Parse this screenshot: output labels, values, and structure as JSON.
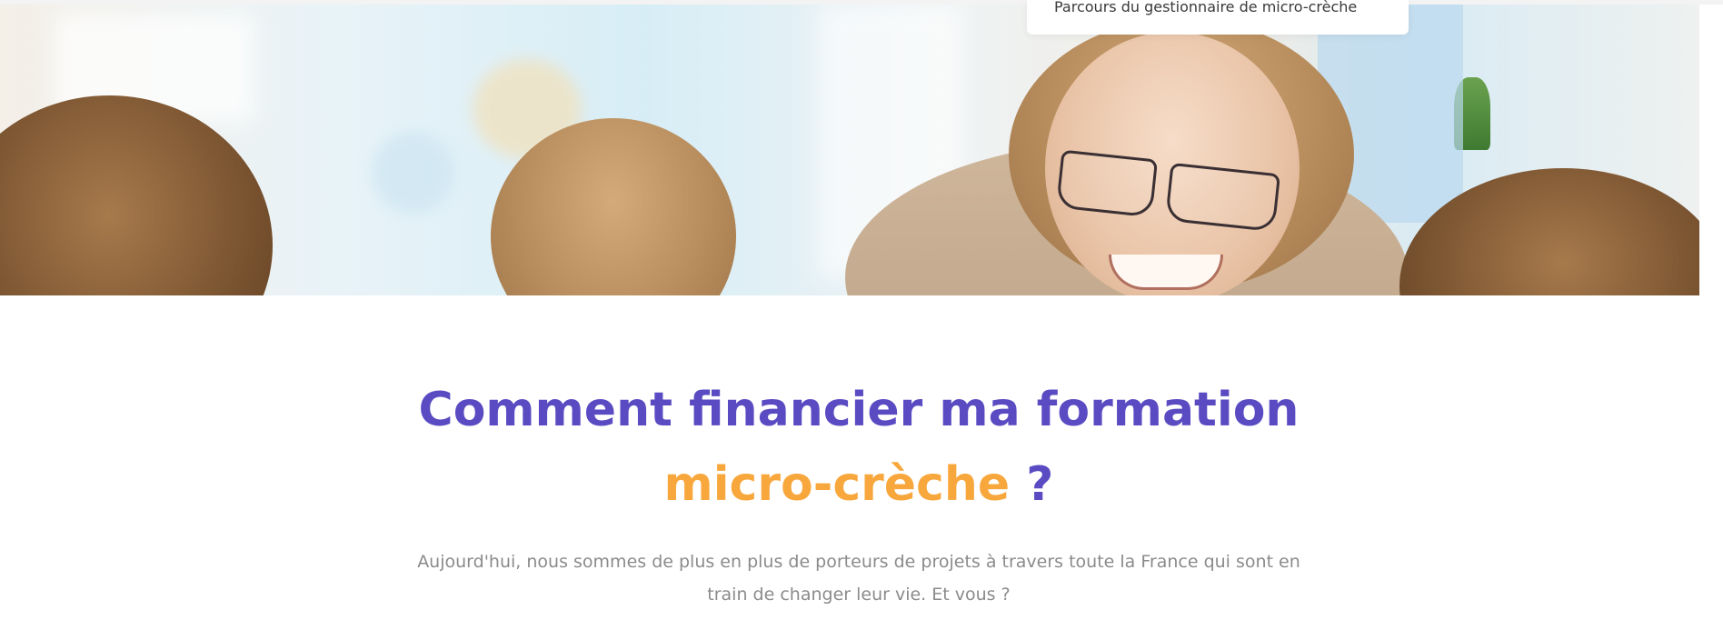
{
  "nav": {
    "dropdown_item": "Parcours du gestionnaire de micro-crèche"
  },
  "hero": {
    "image_alt": "Éducatrice souriante avec des enfants"
  },
  "section": {
    "heading_part1": "Comment financier ma formation",
    "heading_accent": "micro-crèche",
    "heading_suffix": "?",
    "lead": "Aujourd'hui, nous sommes de plus en plus de porteurs de projets à travers toute la France qui sont en train de changer leur vie. Et vous ?"
  },
  "colors": {
    "heading_primary": "#5a4bc2",
    "heading_accent": "#f8a73c",
    "body_text": "#8b8b8b"
  }
}
